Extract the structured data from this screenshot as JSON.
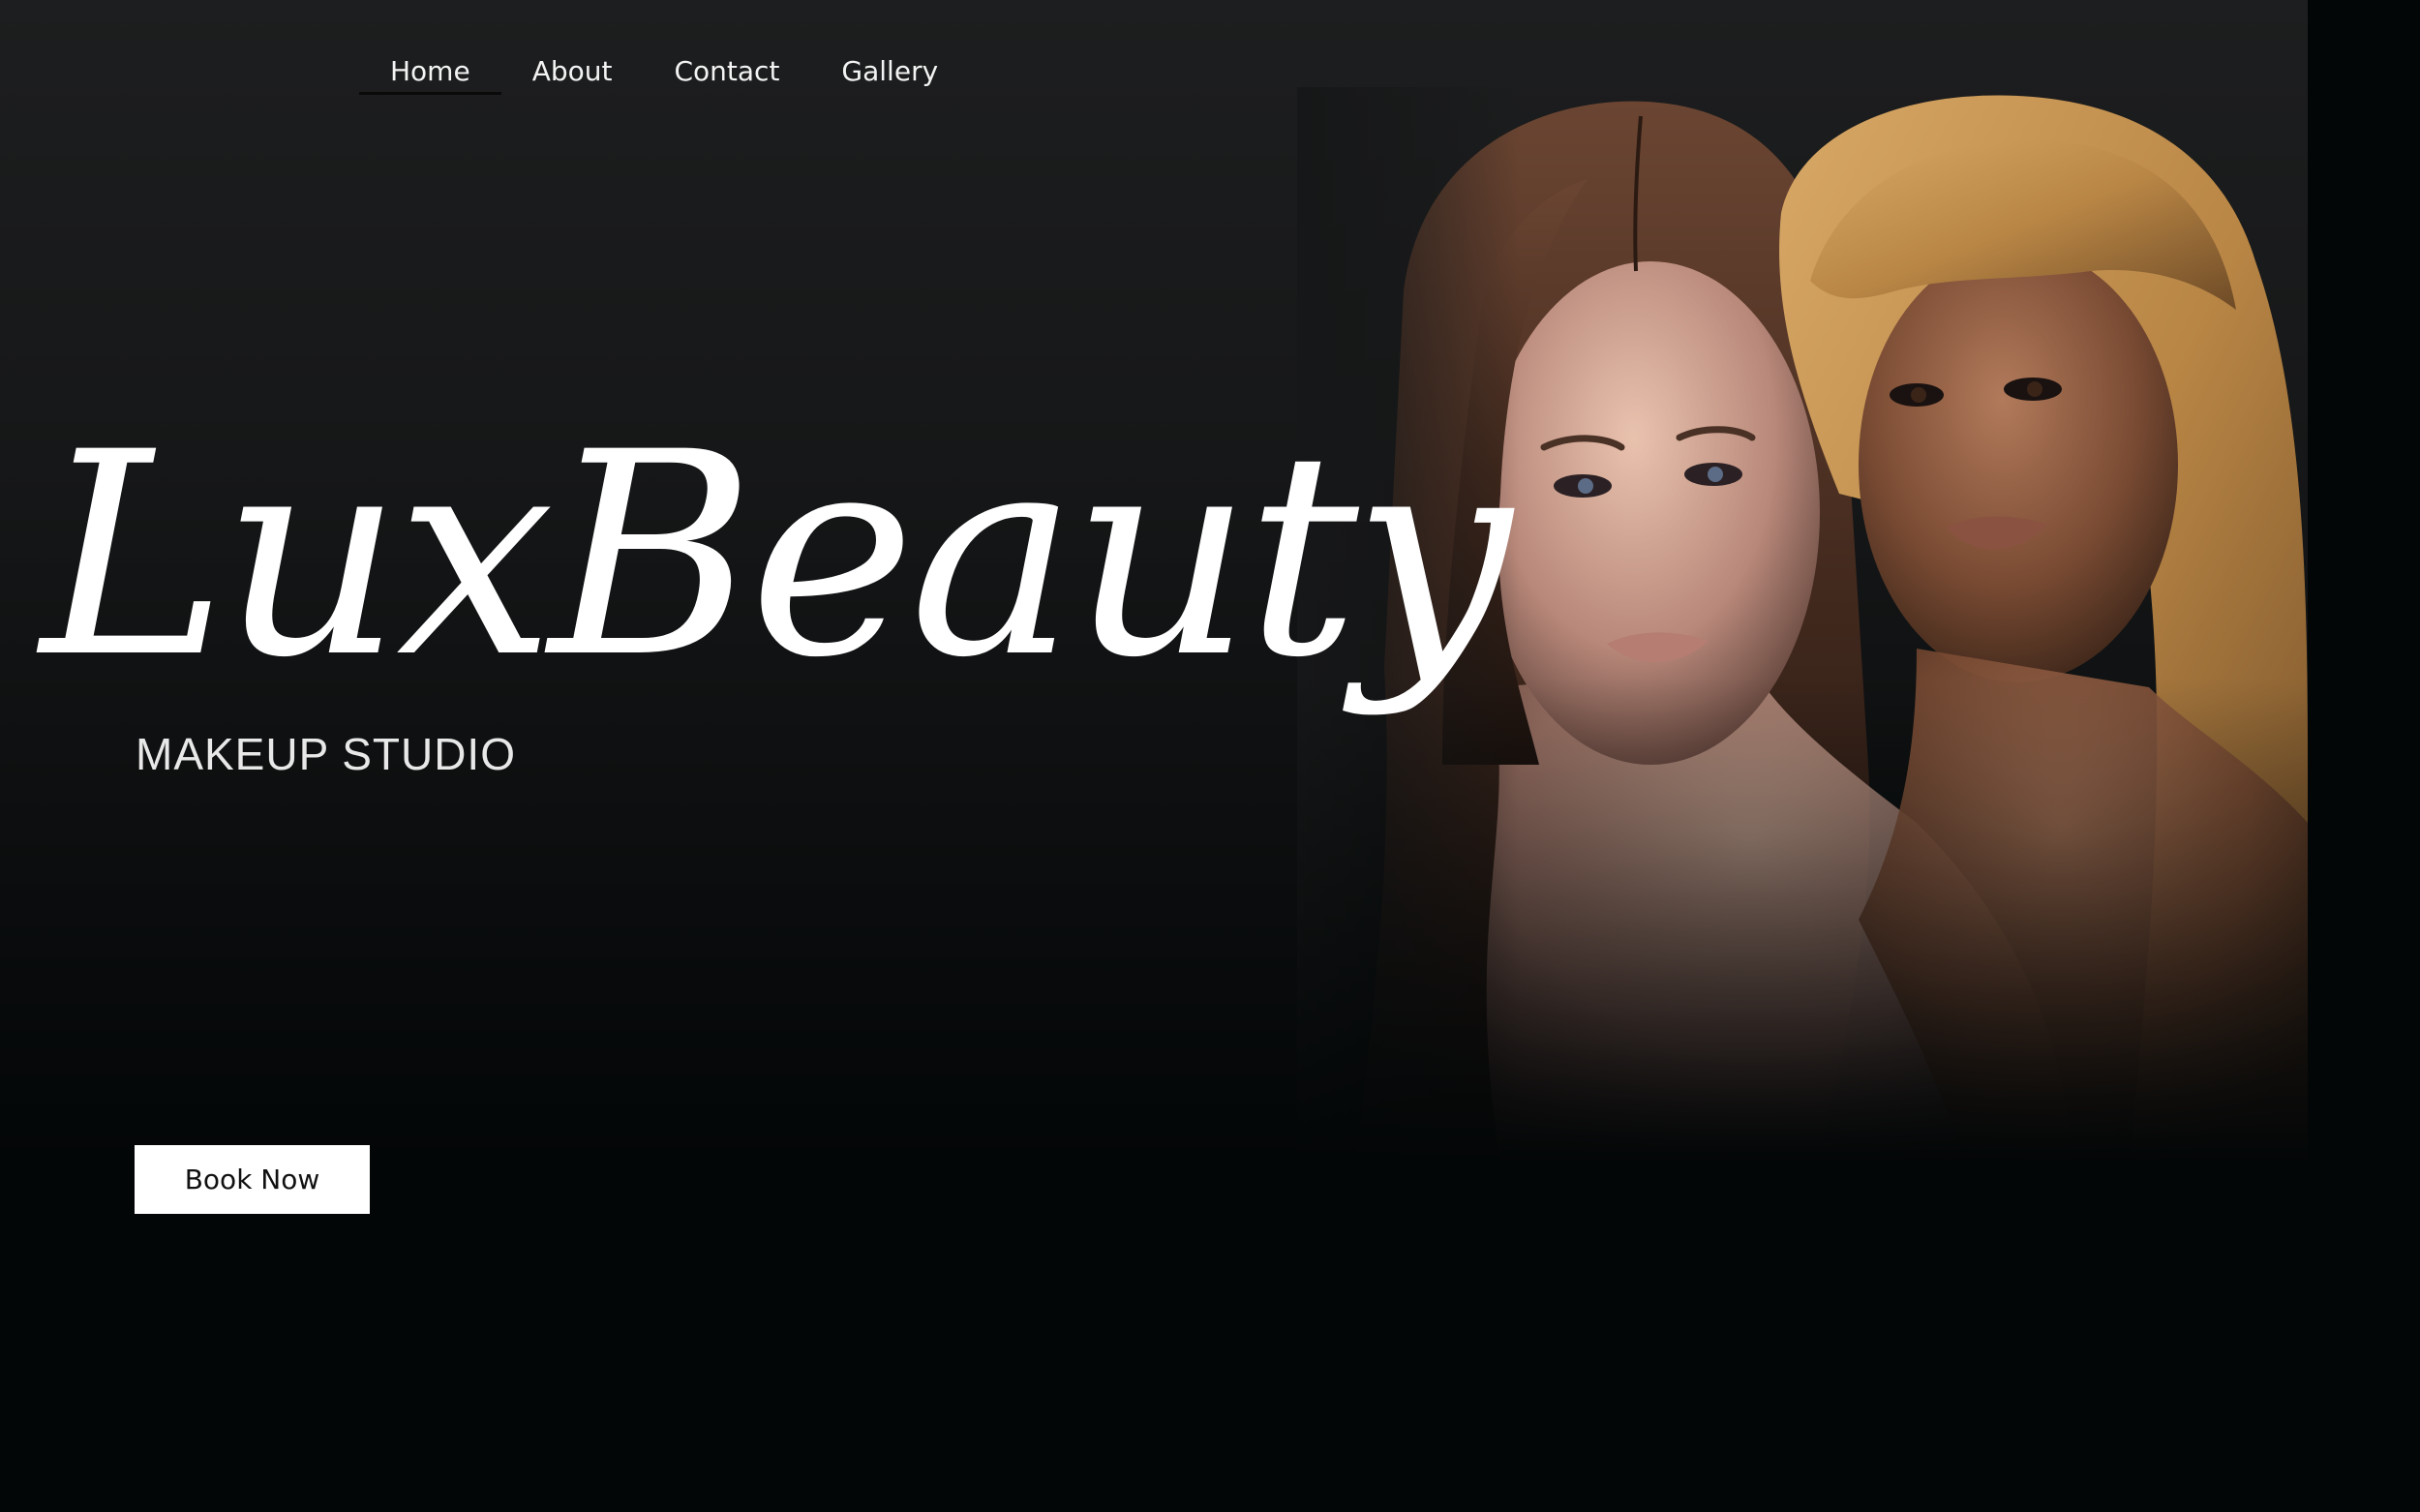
{
  "nav": {
    "items": [
      {
        "label": "Home",
        "active": true
      },
      {
        "label": "About",
        "active": false
      },
      {
        "label": "Contact",
        "active": false
      },
      {
        "label": "Gallery",
        "active": false
      }
    ]
  },
  "hero": {
    "title": "LuxBeauty",
    "subtitle": "MAKEUP STUDIO",
    "cta_label": "Book Now"
  },
  "colors": {
    "background": "#030607",
    "hero_top": "#1d1e1f",
    "text": "#ffffff",
    "button_bg": "#ffffff",
    "button_text": "#111111"
  }
}
